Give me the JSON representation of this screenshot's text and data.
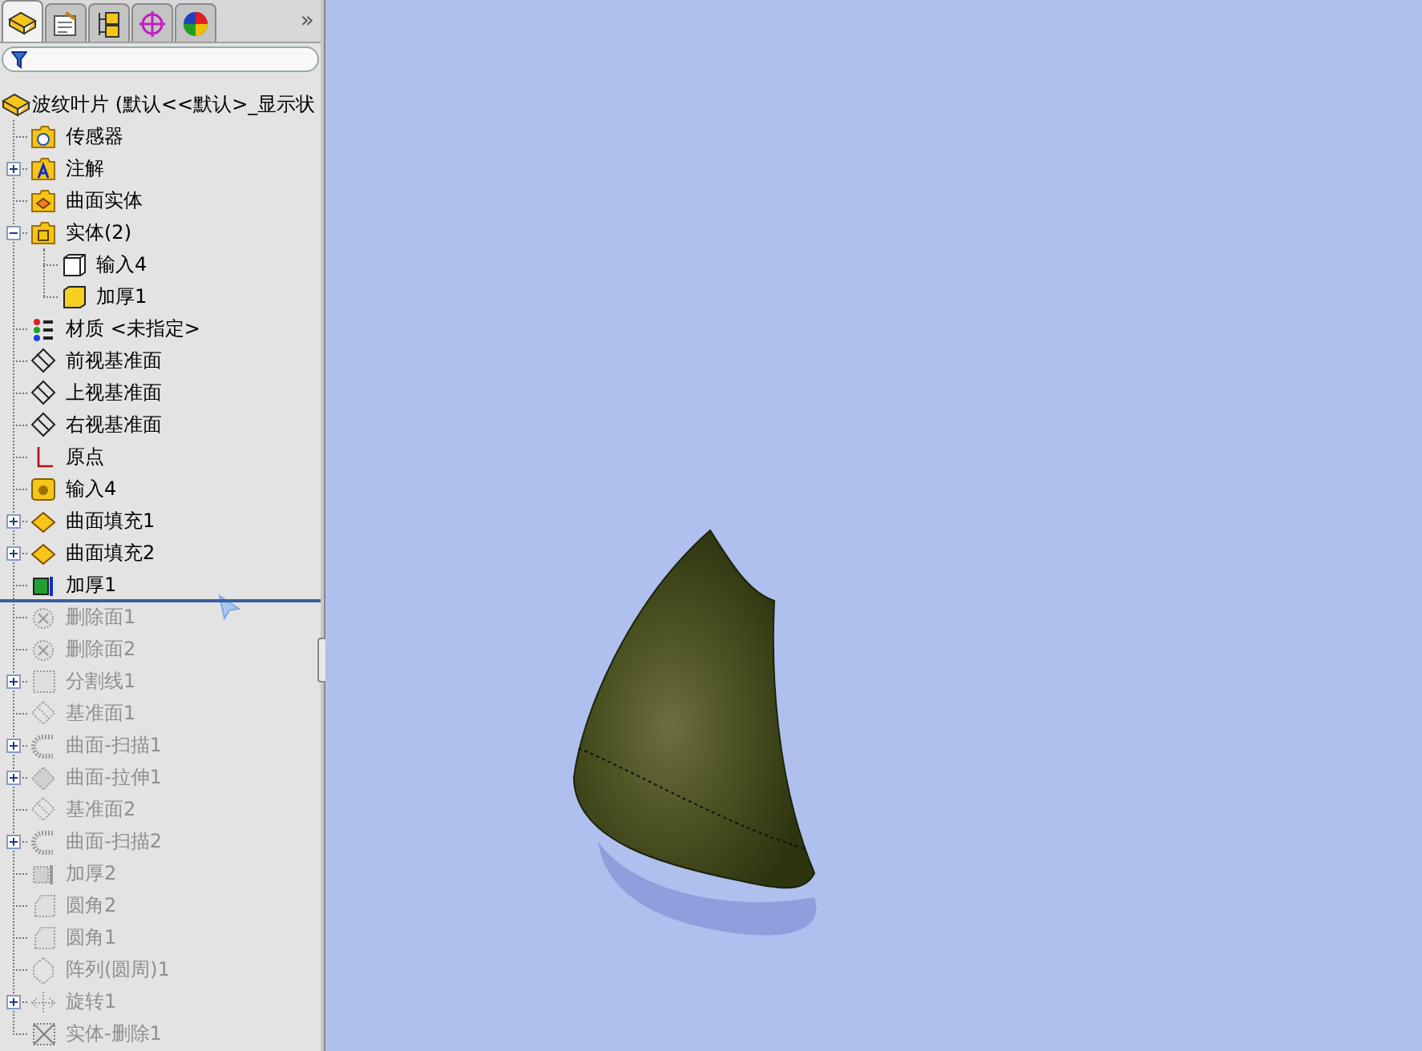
{
  "panel": {
    "tabs": [
      {
        "kind": "feature",
        "selected": true
      },
      {
        "kind": "property",
        "selected": false
      },
      {
        "kind": "config",
        "selected": false
      },
      {
        "kind": "dimxpert",
        "selected": false
      },
      {
        "kind": "display",
        "selected": false
      }
    ],
    "more": "»",
    "tree": {
      "root": "波纹叶片  (默认<<默认>_显示状",
      "items": [
        {
          "label": "传感器",
          "kind": "sensor",
          "disabled": false
        },
        {
          "label": "注解",
          "kind": "annotation",
          "expanded": false,
          "disabled": false
        },
        {
          "label": "曲面实体",
          "kind": "surface-folder",
          "disabled": false
        },
        {
          "label": "实体(2)",
          "kind": "solid-folder",
          "expanded": true,
          "disabled": false,
          "children": [
            {
              "label": "输入4",
              "kind": "body-outline",
              "disabled": false
            },
            {
              "label": "加厚1",
              "kind": "body-solid",
              "disabled": false
            }
          ]
        },
        {
          "label": "材质 <未指定>",
          "kind": "material",
          "disabled": false
        },
        {
          "label": "前视基准面",
          "kind": "plane",
          "disabled": false
        },
        {
          "label": "上视基准面",
          "kind": "plane",
          "disabled": false
        },
        {
          "label": "右视基准面",
          "kind": "plane",
          "disabled": false
        },
        {
          "label": "原点",
          "kind": "origin",
          "disabled": false
        },
        {
          "label": "输入4",
          "kind": "import",
          "disabled": false
        },
        {
          "label": "曲面填充1",
          "kind": "fill",
          "expanded": false,
          "disabled": false
        },
        {
          "label": "曲面填充2",
          "kind": "fill",
          "expanded": false,
          "disabled": false
        },
        {
          "label": "加厚1",
          "kind": "thicken",
          "disabled": false
        },
        {
          "label": "删除面1",
          "kind": "delete-face",
          "disabled": true
        },
        {
          "label": "删除面2",
          "kind": "delete-face",
          "disabled": true
        },
        {
          "label": "分割线1",
          "kind": "split-line",
          "expanded": false,
          "disabled": true
        },
        {
          "label": "基准面1",
          "kind": "plane",
          "disabled": true
        },
        {
          "label": "曲面-扫描1",
          "kind": "sweep",
          "expanded": false,
          "disabled": true
        },
        {
          "label": "曲面-拉伸1",
          "kind": "extrude",
          "expanded": false,
          "disabled": true
        },
        {
          "label": "基准面2",
          "kind": "plane",
          "disabled": true
        },
        {
          "label": "曲面-扫描2",
          "kind": "sweep",
          "expanded": false,
          "disabled": true
        },
        {
          "label": "加厚2",
          "kind": "thicken",
          "disabled": true
        },
        {
          "label": "圆角2",
          "kind": "fillet",
          "disabled": true
        },
        {
          "label": "圆角1",
          "kind": "fillet",
          "disabled": true
        },
        {
          "label": "阵列(圆周)1",
          "kind": "pattern",
          "disabled": true
        },
        {
          "label": "旋转1",
          "kind": "revolve",
          "expanded": false,
          "disabled": true
        },
        {
          "label": "实体-删除1",
          "kind": "body-delete",
          "disabled": true
        }
      ]
    }
  }
}
